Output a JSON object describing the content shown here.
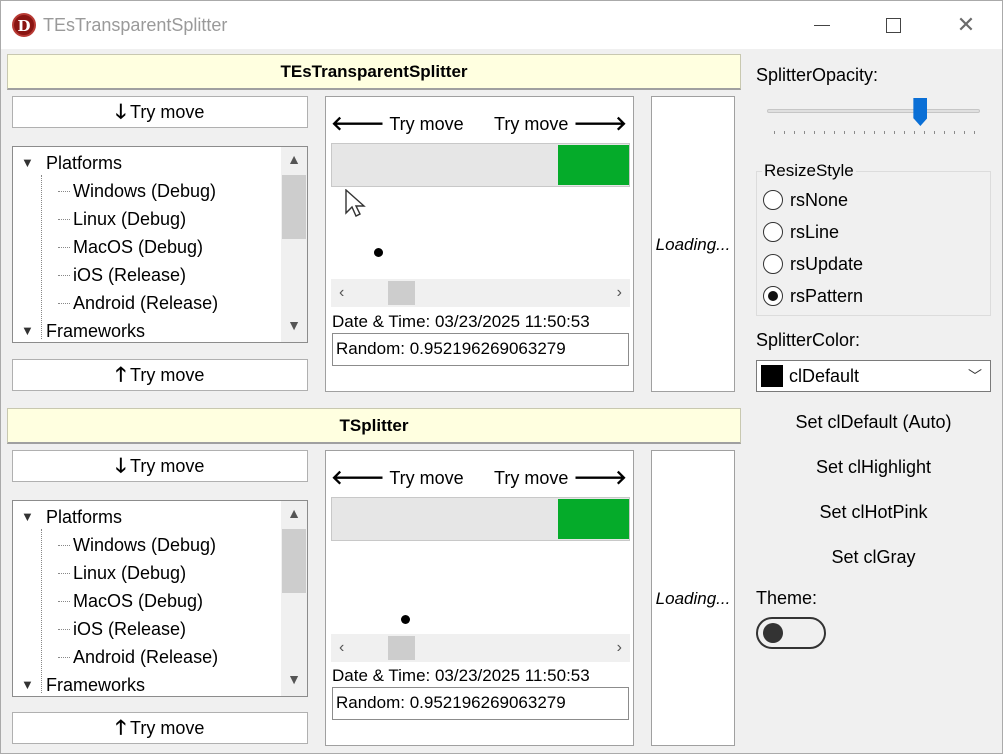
{
  "window": {
    "title": "TEsTransparentSplitter",
    "app_icon_letter": "D",
    "controls": [
      "minimize",
      "maximize",
      "close"
    ]
  },
  "panels": [
    {
      "header": "TEsTransparentSplitter",
      "top_button": "Try move",
      "bottom_button": "Try move",
      "tree": [
        {
          "label": "Platforms",
          "level": 0,
          "expanded": true
        },
        {
          "label": "Windows (Debug)",
          "level": 1
        },
        {
          "label": "Linux (Debug)",
          "level": 1
        },
        {
          "label": "MacOS (Debug)",
          "level": 1
        },
        {
          "label": "iOS (Release)",
          "level": 1
        },
        {
          "label": "Android (Release)",
          "level": 1
        },
        {
          "label": "Frameworks",
          "level": 0,
          "expanded": true
        }
      ],
      "try_left": "Try move",
      "try_right": "Try move",
      "datetime": "Date & Time: 03/23/2025 11:50:53",
      "random": "Random: 0.952196269063279",
      "loading": "Loading..."
    },
    {
      "header": "TSplitter",
      "top_button": "Try move",
      "bottom_button": "Try move",
      "tree": [
        {
          "label": "Platforms",
          "level": 0,
          "expanded": true
        },
        {
          "label": "Windows (Debug)",
          "level": 1
        },
        {
          "label": "Linux (Debug)",
          "level": 1
        },
        {
          "label": "MacOS (Debug)",
          "level": 1
        },
        {
          "label": "iOS (Release)",
          "level": 1
        },
        {
          "label": "Android (Release)",
          "level": 1
        },
        {
          "label": "Frameworks",
          "level": 0,
          "expanded": true
        }
      ],
      "try_left": "Try move",
      "try_right": "Try move",
      "datetime": "Date & Time: 03/23/2025 11:50:53",
      "random": "Random: 0.952196269063279",
      "loading": "Loading..."
    }
  ],
  "settings": {
    "opacity_label": "SplitterOpacity:",
    "opacity_fraction": 0.72,
    "resize_style_title": "ResizeStyle",
    "resize_options": [
      "rsNone",
      "rsLine",
      "rsUpdate",
      "rsPattern"
    ],
    "resize_selected": "rsPattern",
    "color_label": "SplitterColor:",
    "color_value": "clDefault",
    "color_swatch": "#000000",
    "color_buttons": [
      "Set clDefault (Auto)",
      "Set clHighlight",
      "Set clHotPink",
      "Set clGray"
    ],
    "theme_label": "Theme:",
    "theme_on": false
  },
  "colors": {
    "header_bg": "#ffffe0",
    "green_block": "#05ab2a",
    "slider_accent": "#0a6fd6"
  }
}
